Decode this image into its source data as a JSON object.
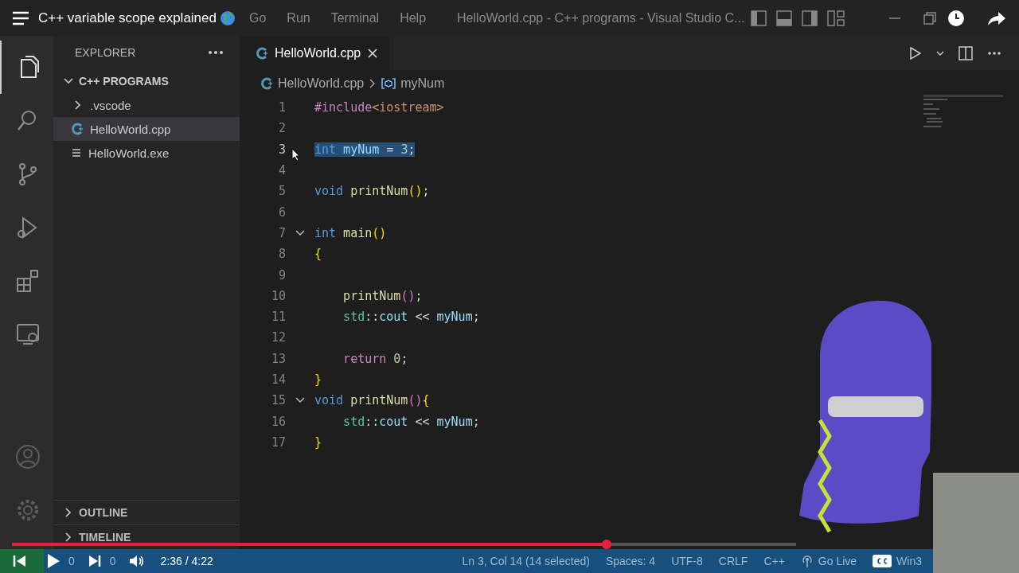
{
  "video_player": {
    "title": "C++ variable scope explained",
    "time": "2:36 / 4:22",
    "progress": {
      "level": 0.758
    }
  },
  "title_bar": {
    "menu": [
      "Go",
      "Run",
      "Terminal",
      "Help"
    ],
    "title": "HelloWorld.cpp - C++ programs - Visual Studio C..."
  },
  "activity_bar": {
    "items": [
      {
        "kind": "files",
        "selected": true
      },
      {
        "kind": "search",
        "selected": false
      },
      {
        "kind": "branch",
        "selected": false
      },
      {
        "kind": "debug",
        "selected": false
      },
      {
        "kind": "extensions",
        "selected": false
      },
      {
        "kind": "remote",
        "selected": false
      }
    ],
    "bottom": [
      {
        "kind": "account"
      },
      {
        "kind": "settings"
      }
    ]
  },
  "sidebar": {
    "title": "EXPLORER",
    "folder": {
      "label": "C++ PROGRAMS",
      "expanded": true
    },
    "tree": [
      {
        "label": ".vscode",
        "kind": "folder",
        "selected": false
      },
      {
        "label": "HelloWorld.cpp",
        "kind": "cpp",
        "selected": true
      },
      {
        "label": "HelloWorld.exe",
        "kind": "file",
        "selected": false
      }
    ],
    "sections": [
      {
        "label": "OUTLINE",
        "expanded": false
      },
      {
        "label": "TIMELINE",
        "expanded": false
      }
    ]
  },
  "editor": {
    "tabs": [
      {
        "label": "HelloWorld.cpp",
        "selected": true
      }
    ],
    "breadcrumb": [
      "HelloWorld.cpp",
      "myNum"
    ],
    "lines": [
      {
        "number": "1",
        "selected": false,
        "fold": false,
        "tokens": [
          {
            "kind": "directive",
            "text": "#include"
          },
          {
            "kind": "string",
            "text": "<iostream>"
          }
        ]
      },
      {
        "number": "2",
        "selected": false,
        "fold": false
      },
      {
        "number": "3",
        "selected": true,
        "fold": false,
        "tokens": [
          {
            "kind": "keyword",
            "text": "int"
          },
          {
            "kind": "variable",
            "text": " myNum"
          },
          {
            "kind": "plain",
            "text": " = "
          },
          {
            "kind": "number",
            "text": "3"
          },
          {
            "kind": "plain",
            "text": ";"
          }
        ]
      },
      {
        "number": "4",
        "selected": false,
        "fold": false
      },
      {
        "number": "5",
        "selected": false,
        "fold": false,
        "tokens": [
          {
            "kind": "keyword",
            "text": "void"
          },
          {
            "kind": "function",
            "text": " printNum"
          },
          {
            "kind": "bracket",
            "text": "()"
          },
          {
            "kind": "plain",
            "text": ";"
          }
        ]
      },
      {
        "number": "6",
        "selected": false,
        "fold": false
      },
      {
        "number": "7",
        "selected": false,
        "fold": true,
        "tokens": [
          {
            "kind": "keyword",
            "text": "int"
          },
          {
            "kind": "function",
            "text": " main"
          },
          {
            "kind": "bracket",
            "text": "()"
          }
        ]
      },
      {
        "number": "8",
        "selected": false,
        "fold": false,
        "tokens": [
          {
            "kind": "bracket",
            "text": "{"
          }
        ]
      },
      {
        "number": "9",
        "selected": false,
        "fold": false
      },
      {
        "number": "10",
        "selected": false,
        "fold": false,
        "tokens": [
          {
            "kind": "function",
            "text": "    printNum"
          },
          {
            "kind": "bracket2",
            "text": "()"
          },
          {
            "kind": "plain",
            "text": ";"
          }
        ]
      },
      {
        "number": "11",
        "selected": false,
        "fold": false,
        "tokens": [
          {
            "kind": "namespace",
            "text": "    std"
          },
          {
            "kind": "plain",
            "text": "::"
          },
          {
            "kind": "variable",
            "text": "cout"
          },
          {
            "kind": "plain",
            "text": " << "
          },
          {
            "kind": "variable",
            "text": "myNum"
          },
          {
            "kind": "plain",
            "text": ";"
          }
        ]
      },
      {
        "number": "12",
        "selected": false,
        "fold": false
      },
      {
        "number": "13",
        "selected": false,
        "fold": false,
        "tokens": [
          {
            "kind": "directive",
            "text": "    return"
          },
          {
            "kind": "number",
            "text": " 0"
          },
          {
            "kind": "plain",
            "text": ";"
          }
        ]
      },
      {
        "number": "14",
        "selected": false,
        "fold": false,
        "tokens": [
          {
            "kind": "bracket",
            "text": "}"
          }
        ]
      },
      {
        "number": "15",
        "selected": false,
        "fold": true,
        "tokens": [
          {
            "kind": "keyword",
            "text": "void"
          },
          {
            "kind": "function",
            "text": " printNum"
          },
          {
            "kind": "bracket2",
            "text": "()"
          },
          {
            "kind": "bracket",
            "text": "{"
          }
        ]
      },
      {
        "number": "16",
        "selected": false,
        "fold": false,
        "tokens": [
          {
            "kind": "namespace",
            "text": "    std"
          },
          {
            "kind": "plain",
            "text": "::"
          },
          {
            "kind": "variable",
            "text": "cout"
          },
          {
            "kind": "plain",
            "text": " << "
          },
          {
            "kind": "variable",
            "text": "myNum"
          },
          {
            "kind": "plain",
            "text": ";"
          }
        ]
      },
      {
        "number": "17",
        "selected": false,
        "fold": false,
        "tokens": [
          {
            "kind": "bracket",
            "text": "}"
          }
        ]
      }
    ]
  },
  "status_bar": {
    "problems": [
      "0",
      "0"
    ],
    "items": [
      {
        "kind": "text",
        "label": "Ln 3, Col 14 (14 selected)"
      },
      {
        "kind": "text",
        "label": "Spaces: 4"
      },
      {
        "kind": "text",
        "label": "UTF-8"
      },
      {
        "kind": "text",
        "label": "CRLF"
      },
      {
        "kind": "text",
        "label": "C++"
      },
      {
        "kind": "live",
        "label": "Go Live"
      },
      {
        "kind": "captions",
        "label": "Win3"
      }
    ]
  }
}
